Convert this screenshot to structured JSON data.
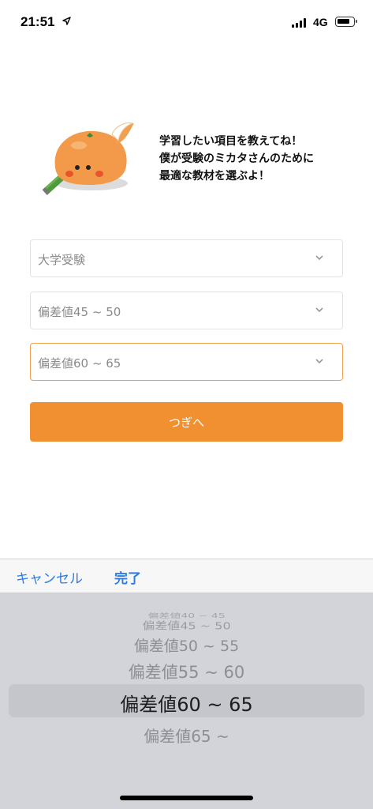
{
  "status_bar": {
    "time": "21:51",
    "network": "4G",
    "icons": [
      "location-arrow-icon",
      "signal-icon",
      "battery-icon"
    ]
  },
  "intro": {
    "message": "学習したい項目を教えてね！\n僕が受験のミカタさんのために\n最適な教材を選ぶよ！",
    "mascot": "orange-mascot-with-pencil"
  },
  "form": {
    "category": "大学受験",
    "current_level": "偏差値45 ~ 50",
    "target_level": "偏差値60 ~ 65",
    "next_label": "つぎへ"
  },
  "picker": {
    "cancel_label": "キャンセル",
    "done_label": "完了",
    "options": [
      {
        "label": "偏差値40 ~ 45"
      },
      {
        "label": "偏差値45 ~ 50"
      },
      {
        "label": "偏差値50 ~ 55"
      },
      {
        "label": "偏差値55 ~ 60"
      },
      {
        "label": "偏差値60 ~ 65",
        "selected": true
      },
      {
        "label": "偏差値65 ~"
      }
    ]
  },
  "colors": {
    "accent": "#f09030",
    "link": "#2f7ce0",
    "active_border": "#f0a050"
  }
}
